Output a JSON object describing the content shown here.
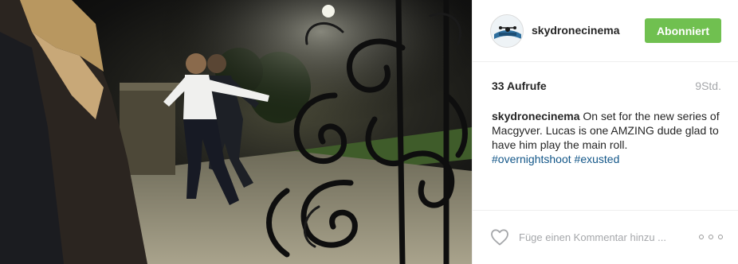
{
  "post": {
    "media": {
      "description_icon": "video-player"
    },
    "header": {
      "username": "skydronecinema",
      "follow_label": "Abonniert",
      "avatar_icon": "drone-avatar-icon"
    },
    "stats": {
      "views": "33 Aufrufe",
      "time": "9Std."
    },
    "caption": {
      "username": "skydronecinema",
      "text": " On set for the new series of Macgyver. Lucas is one AMZING dude glad to have him play the main roll.",
      "hashtags": [
        "#overnightshoot",
        "#exusted"
      ]
    },
    "footer": {
      "like_icon": "heart-icon",
      "comment_placeholder": "Füge einen Kommentar hinzu ...",
      "more_icon": "more-options-icon"
    },
    "colors": {
      "follow_button": "#70c050",
      "hashtag": "#125688",
      "muted_text": "#a5a7aa",
      "divider": "#efefef"
    }
  }
}
